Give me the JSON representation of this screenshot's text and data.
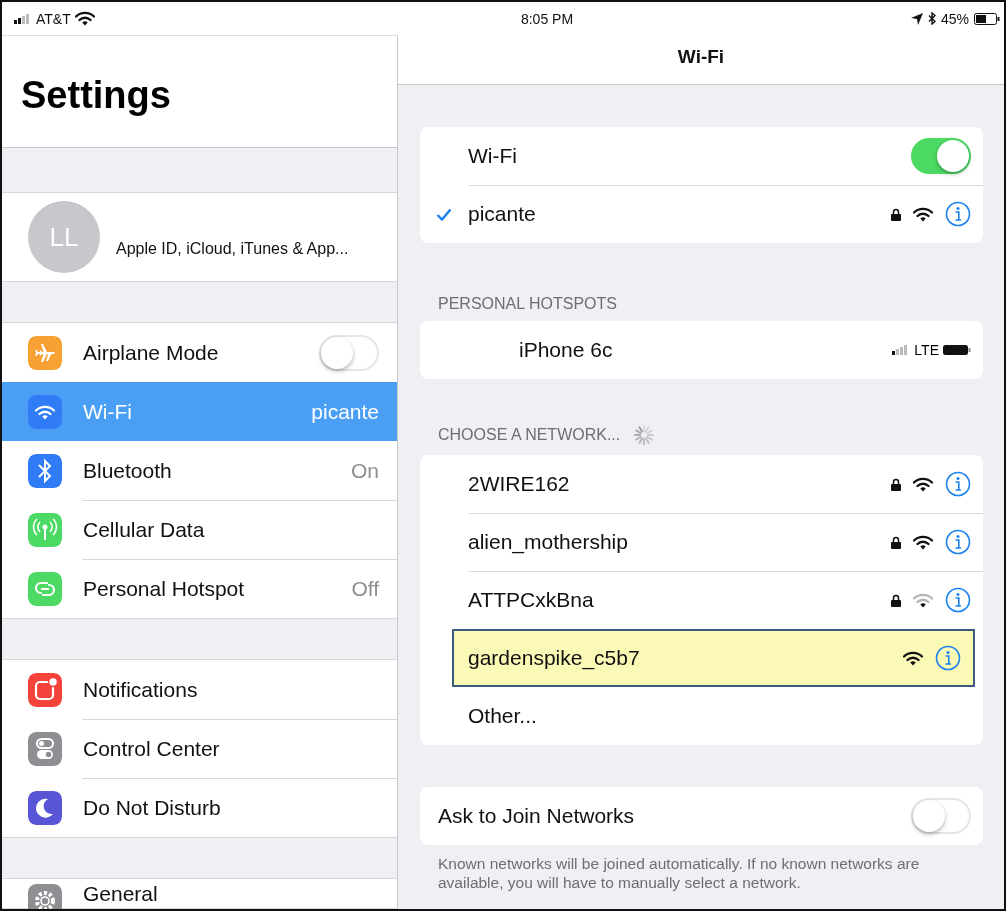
{
  "status_bar": {
    "carrier": "AT&T",
    "time": "8:05 PM",
    "battery": "45%"
  },
  "sidebar": {
    "title": "Settings",
    "profile": {
      "initials": "LL",
      "subtitle": "Apple ID, iCloud, iTunes & App..."
    },
    "groups": [
      {
        "items": [
          {
            "label": "Airplane Mode",
            "color": "#f7a033",
            "kind": "toggle",
            "on": false,
            "selected": false
          },
          {
            "label": "Wi-Fi",
            "color": "#2f7cf6",
            "kind": "value",
            "value": "picante",
            "selected": true
          },
          {
            "label": "Bluetooth",
            "color": "#2f7cf6",
            "kind": "value",
            "value": "On",
            "selected": false
          },
          {
            "label": "Cellular Data",
            "color": "#4cd964",
            "kind": "plain",
            "selected": false
          },
          {
            "label": "Personal Hotspot",
            "color": "#4cd964",
            "kind": "value",
            "value": "Off",
            "selected": false
          }
        ]
      },
      {
        "items": [
          {
            "label": "Notifications",
            "color": "#f4433a",
            "kind": "plain",
            "selected": false
          },
          {
            "label": "Control Center",
            "color": "#8e8e93",
            "kind": "plain",
            "selected": false
          },
          {
            "label": "Do Not Disturb",
            "color": "#5856d6",
            "kind": "plain",
            "selected": false
          }
        ]
      },
      {
        "items": [
          {
            "label": "General",
            "color": "#8e8e93",
            "kind": "plain",
            "selected": false
          }
        ]
      }
    ]
  },
  "detail": {
    "title": "Wi-Fi",
    "wifi_toggle": {
      "label": "Wi-Fi",
      "on": true
    },
    "current_network": {
      "name": "picante",
      "checked": true,
      "secure": true
    },
    "hotspots_header": "PERSONAL HOTSPOTS",
    "hotspots": [
      {
        "name": "iPhone 6c",
        "network": "LTE"
      }
    ],
    "networks_header": "CHOOSE A NETWORK...",
    "networks": [
      {
        "name": "2WIRE162",
        "secure": true,
        "weak_signal": false,
        "highlighted": false
      },
      {
        "name": "alien_mothership",
        "secure": true,
        "weak_signal": false,
        "highlighted": false
      },
      {
        "name": "ATTPCxkBna",
        "secure": true,
        "weak_signal": true,
        "highlighted": false
      },
      {
        "name": "gardenspike_c5b7",
        "secure": false,
        "weak_signal": false,
        "highlighted": true
      }
    ],
    "other": "Other...",
    "ask_to_join": {
      "label": "Ask to Join Networks",
      "on": false
    },
    "footer": "Known networks will be joined automatically. If no known networks are available, you will have to manually select a network."
  }
}
